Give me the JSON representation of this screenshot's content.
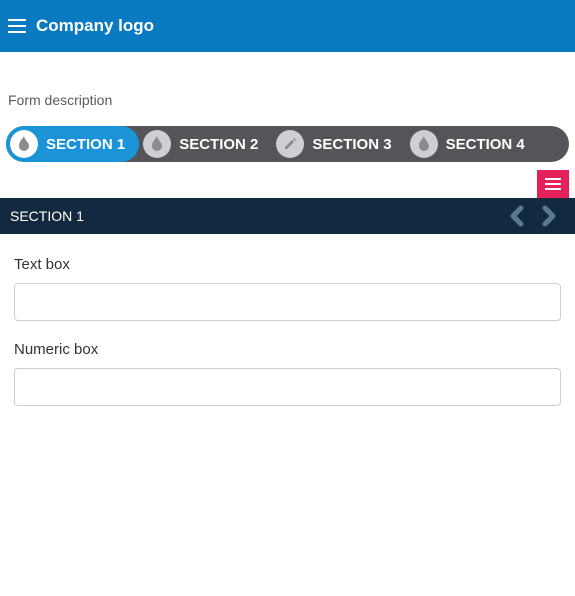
{
  "header": {
    "logo_text": "Company logo"
  },
  "form": {
    "description": "Form description",
    "current_section_title": "SECTION 1"
  },
  "tabs": [
    {
      "label": "SECTION 1",
      "icon": "flame-icon",
      "active": true
    },
    {
      "label": "SECTION 2",
      "icon": "flame-icon",
      "active": false
    },
    {
      "label": "SECTION 3",
      "icon": "pencil-icon",
      "active": false
    },
    {
      "label": "SECTION 4",
      "icon": "flame-icon",
      "active": false
    }
  ],
  "fields": [
    {
      "label": "Text box",
      "value": ""
    },
    {
      "label": "Numeric box",
      "value": ""
    }
  ],
  "colors": {
    "topbar": "#0979c0",
    "tab_bg": "#555458",
    "tab_active": "#1b93d7",
    "section_header": "#13293f",
    "action_btn": "#e5215c"
  }
}
